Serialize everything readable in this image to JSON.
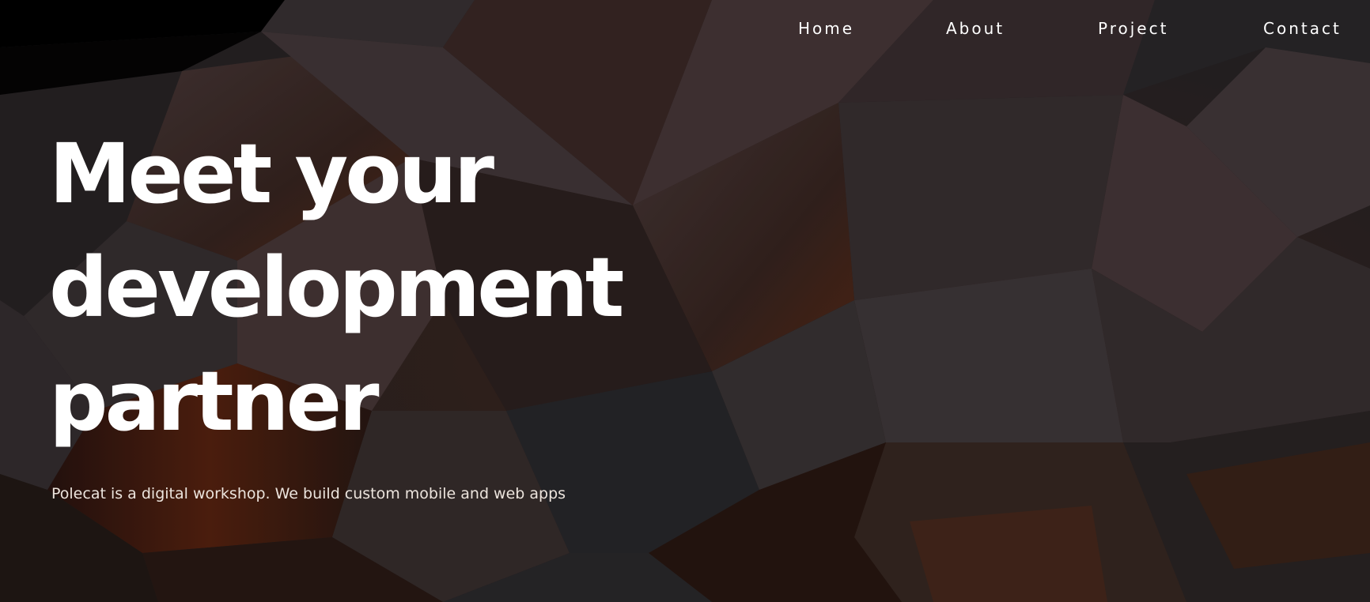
{
  "nav": {
    "items": [
      {
        "label": "Home"
      },
      {
        "label": "About"
      },
      {
        "label": "Project"
      },
      {
        "label": "Contact"
      }
    ]
  },
  "hero": {
    "headline_lines": [
      "Meet your",
      "development",
      "partner"
    ],
    "subtitle": "Polecat is a digital workshop. We build custom mobile and web apps"
  },
  "colors": {
    "background": "#000000",
    "text": "#ffffff",
    "subtitle_text": "#ece4dd",
    "shape_light": "#3a3436",
    "shape_warm": "#4a2a20"
  },
  "background_image": "abstract-geometric-shards"
}
